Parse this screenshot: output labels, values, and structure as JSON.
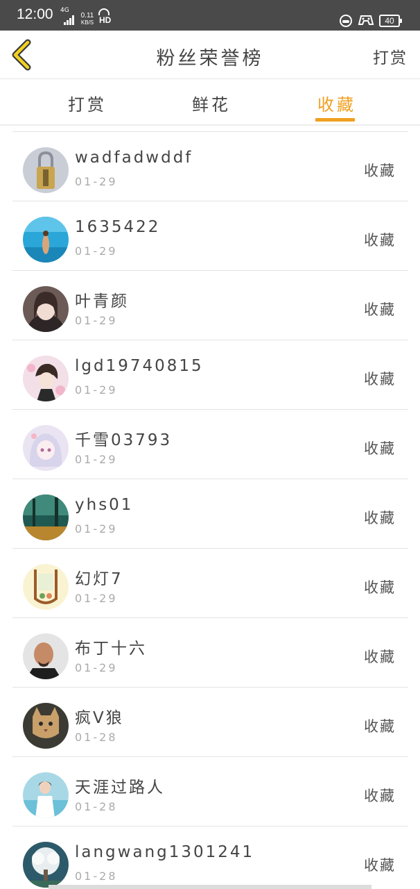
{
  "status_bar": {
    "time": "12:00",
    "network": "4G",
    "speed_value": "0.11",
    "speed_unit": "KB/S",
    "hd": "HD",
    "battery": "40"
  },
  "header": {
    "title": "粉丝荣誉榜",
    "action_label": "打赏",
    "accent_color": "#f0a020"
  },
  "tabs": [
    {
      "label": "打赏",
      "active": false
    },
    {
      "label": "鲜花",
      "active": false
    },
    {
      "label": "收藏",
      "active": true
    }
  ],
  "fans": [
    {
      "name": "wadfadwddf",
      "date": "01-29",
      "type": "收藏",
      "avatar": "padlock-avatar"
    },
    {
      "name": "1635422",
      "date": "01-29",
      "type": "收藏",
      "avatar": "beach-avatar"
    },
    {
      "name": "叶青颜",
      "date": "01-29",
      "type": "收藏",
      "avatar": "girl-portrait-avatar"
    },
    {
      "name": "lgd19740815",
      "date": "01-29",
      "type": "收藏",
      "avatar": "anime-boy-avatar"
    },
    {
      "name": "千雪03793",
      "date": "01-29",
      "type": "收藏",
      "avatar": "anime-girl-avatar"
    },
    {
      "name": "yhs01",
      "date": "01-29",
      "type": "收藏",
      "avatar": "forest-avatar"
    },
    {
      "name": "幻灯7",
      "date": "01-29",
      "type": "收藏",
      "avatar": "illustration-avatar"
    },
    {
      "name": "布丁十六",
      "date": "01-29",
      "type": "收藏",
      "avatar": "man-portrait-avatar"
    },
    {
      "name": "疯V狼",
      "date": "01-28",
      "type": "收藏",
      "avatar": "cat-avatar"
    },
    {
      "name": "天涯过路人",
      "date": "01-28",
      "type": "收藏",
      "avatar": "seaside-woman-avatar"
    },
    {
      "name": "langwang1301241",
      "date": "01-28",
      "type": "收藏",
      "avatar": "white-tree-avatar"
    }
  ]
}
